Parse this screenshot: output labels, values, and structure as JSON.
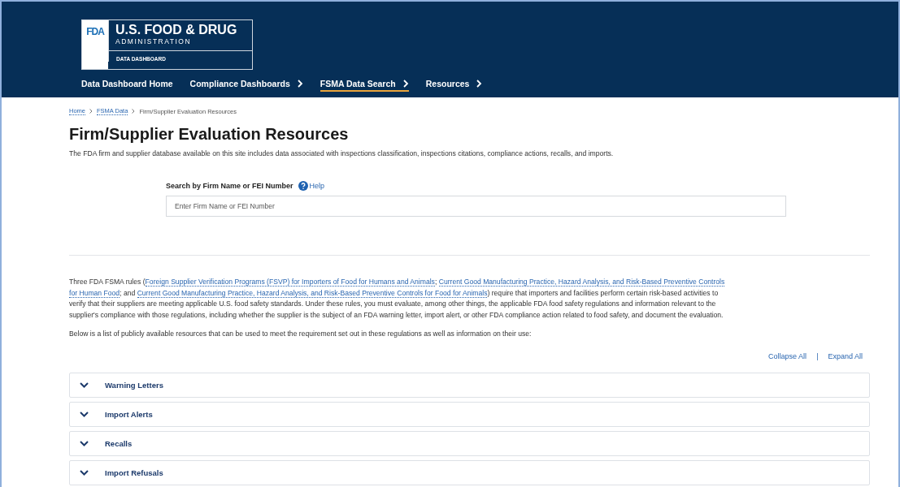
{
  "logo": {
    "mark": "FDA",
    "title": "U.S. FOOD & DRUG",
    "subtitle": "ADMINISTRATION",
    "product": "DATA DASHBOARD"
  },
  "nav": [
    {
      "label": "Data Dashboard Home",
      "selected": false,
      "has_menu": false
    },
    {
      "label": "Compliance Dashboards",
      "selected": false,
      "has_menu": true
    },
    {
      "label": "FSMA Data Search",
      "selected": true,
      "has_menu": true
    },
    {
      "label": "Resources",
      "selected": false,
      "has_menu": true
    }
  ],
  "breadcrumbs": [
    {
      "label": "Home",
      "link": true
    },
    {
      "label": "FSMA Data",
      "link": true
    },
    {
      "label": "Firm/Supplier Evaluation Resources",
      "link": false
    }
  ],
  "page_title": "Firm/Supplier Evaluation Resources",
  "description": "The FDA firm and supplier database available on this site includes data associated with inspections classification, inspections citations, compliance actions, recalls, and imports.",
  "search": {
    "label": "Search by Firm Name or FEI Number",
    "help": "Help",
    "placeholder": "Enter Firm Name or FEI Number"
  },
  "intro_lines": [
    [
      {
        "text": "Three FDA FSMA rules (",
        "link": false
      },
      {
        "text": "Foreign Supplier Verification Programs (FSVP) for Importers of Food for Humans and Animals",
        "link": true
      },
      {
        "text": "; ",
        "link": false
      },
      {
        "text": "Current Good Manufacturing Practice, Hazard Analysis, and Risk-Based Preventive Controls",
        "link": true
      }
    ],
    [
      {
        "text": "for Human Food",
        "link": true
      },
      {
        "text": "; and ",
        "link": false
      },
      {
        "text": "Current Good Manufacturing Practice, Hazard Analysis, and Risk-Based Preventive Controls for Food for Animals",
        "link": true
      },
      {
        "text": ") require that importers and facilities perform certain risk-based activities to",
        "link": false
      }
    ],
    [
      {
        "text": "verify that their suppliers are meeting applicable U.S. food safety standards. Under these rules, you must evaluate, among other things, the applicable FDA food safety regulations and information relevant to the",
        "link": false
      }
    ],
    [
      {
        "text": "supplier's compliance with those regulations, including whether the supplier is the subject of an FDA warning letter, import alert, or other FDA compliance action related to food safety, and document the evaluation.",
        "link": false
      }
    ]
  ],
  "list_intro": "Below is a list of publicly available resources that can be used to meet the requirement set out in these regulations as well as information on their use:",
  "toggles": {
    "collapse": "Collapse All",
    "separator": "|",
    "expand": "Expand All"
  },
  "sections": [
    {
      "title": "Warning Letters",
      "expanded": false
    },
    {
      "title": "Import Alerts",
      "expanded": false
    },
    {
      "title": "Recalls",
      "expanded": false
    },
    {
      "title": "Import Refusals",
      "expanded": false
    }
  ]
}
